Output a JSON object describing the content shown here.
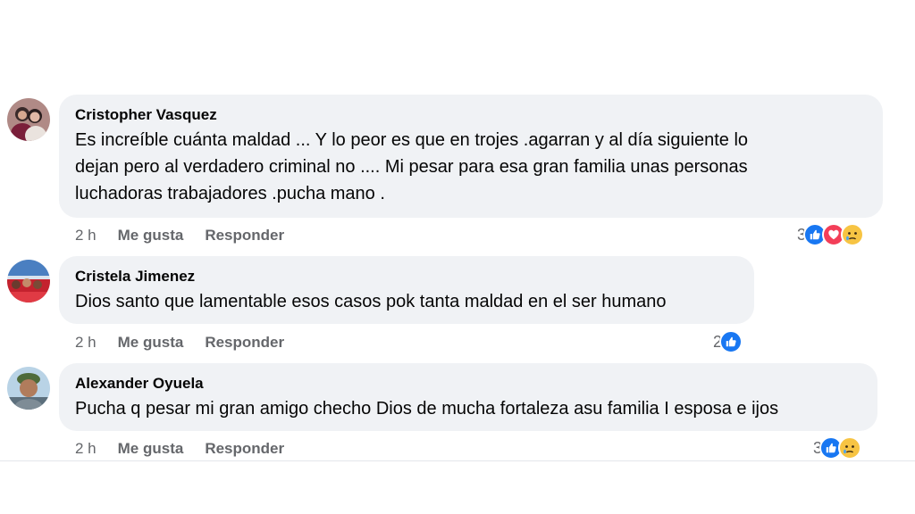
{
  "comments": [
    {
      "author": "Cristopher Vasquez",
      "lines": [
        "Es increíble cuánta maldad ... Y lo peor es que en trojes .agarran y al día siguiente lo",
        "dejan pero al verdadero criminal no .... Mi pesar para esa gran familia unas personas",
        "luchadoras trabajadores .pucha mano ."
      ],
      "time": "2 h",
      "like_label": "Me gusta",
      "reply_label": "Responder",
      "reaction_count": "3",
      "reactions": [
        "like-icon",
        "love-icon",
        "sad-icon"
      ]
    },
    {
      "author": "Cristela Jimenez",
      "lines": [
        "Dios santo que lamentable esos casos pok tanta maldad en el ser humano"
      ],
      "time": "2 h",
      "like_label": "Me gusta",
      "reply_label": "Responder",
      "reaction_count": "2",
      "reactions": [
        "like-icon"
      ]
    },
    {
      "author": "Alexander Oyuela",
      "lines": [
        "Pucha q pesar mi gran amigo checho Dios de mucha fortaleza asu familia I esposa e ijos"
      ],
      "time": "2 h",
      "like_label": "Me gusta",
      "reply_label": "Responder",
      "reaction_count": "3",
      "reactions": [
        "like-icon",
        "sad-icon"
      ]
    }
  ],
  "colors": {
    "bubble": "#f0f2f5",
    "like": "#1877f2",
    "love": "#f33e58",
    "sad": "#f7c443",
    "meta_text": "#65676b"
  }
}
